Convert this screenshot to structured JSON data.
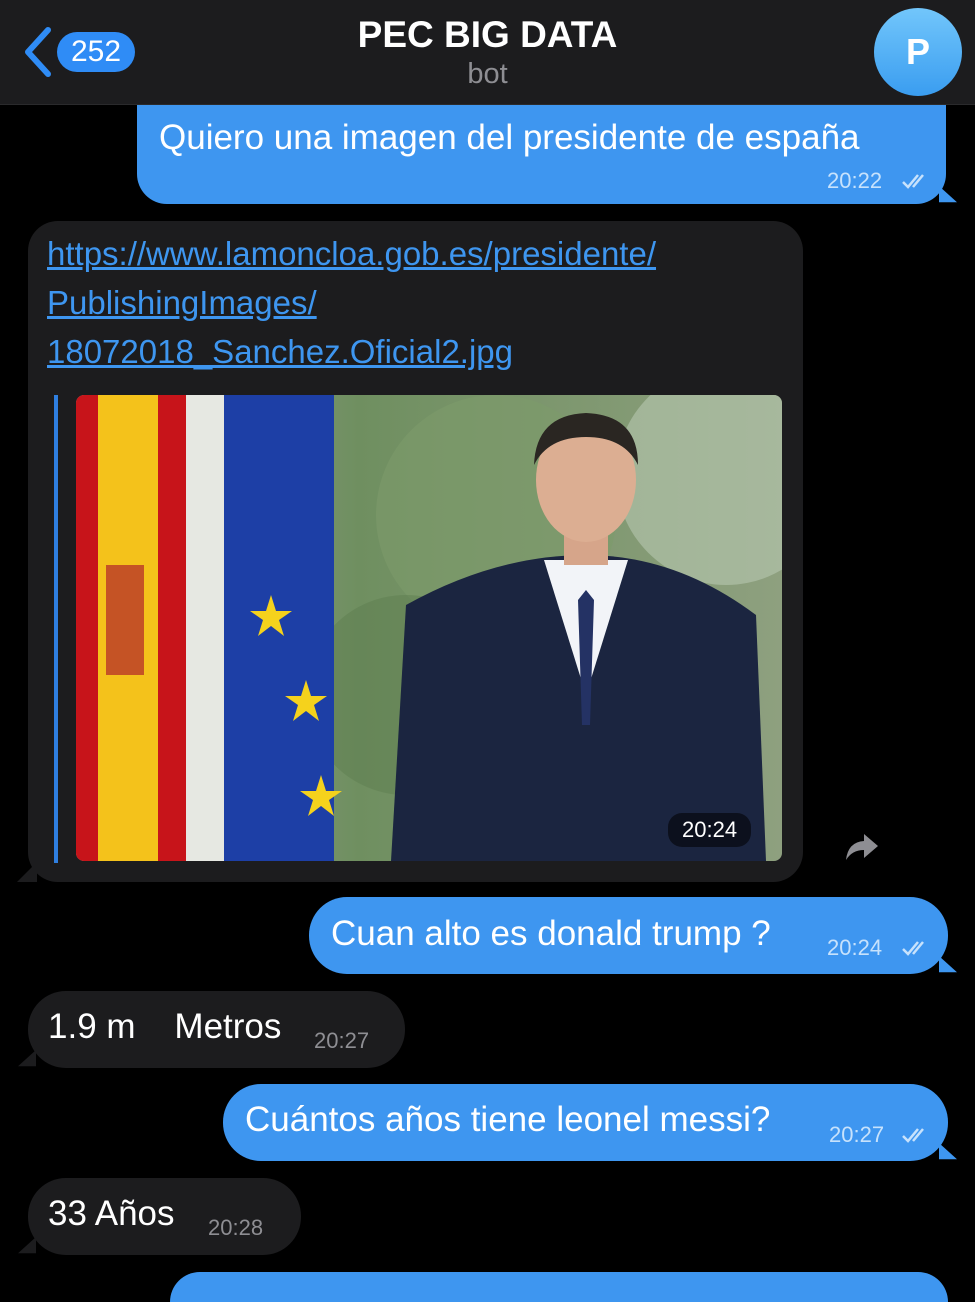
{
  "header": {
    "back_count": "252",
    "title": "PEC BIG DATA",
    "subtitle": "bot",
    "avatar_letter": "P"
  },
  "messages": [
    {
      "type": "outgoing",
      "text": "Quiero una imagen del presidente de españa",
      "time": "20:22",
      "status": "read"
    },
    {
      "type": "incoming",
      "link_lines": [
        "https://www.lamoncloa.gob.es/presidente/",
        "PublishingImages/",
        "18072018_Sanchez.Oficial2.jpg"
      ],
      "time": "20:24",
      "has_image_preview": true,
      "icon": "share-icon"
    },
    {
      "type": "outgoing",
      "text": "Cuan alto es donald trump ?",
      "time": "20:24",
      "status": "read"
    },
    {
      "type": "incoming",
      "text": "1.9 m    Metros",
      "time": "20:27"
    },
    {
      "type": "outgoing",
      "text": "Cuántos años tiene leonel messi?",
      "time": "20:27",
      "status": "read"
    },
    {
      "type": "incoming",
      "text": "33 Años",
      "time": "20:28"
    }
  ],
  "colors": {
    "background": "#000000",
    "outgoing_bubble": "#3e96f0",
    "incoming_bubble": "#1c1c1e",
    "link": "#3e96f0"
  }
}
